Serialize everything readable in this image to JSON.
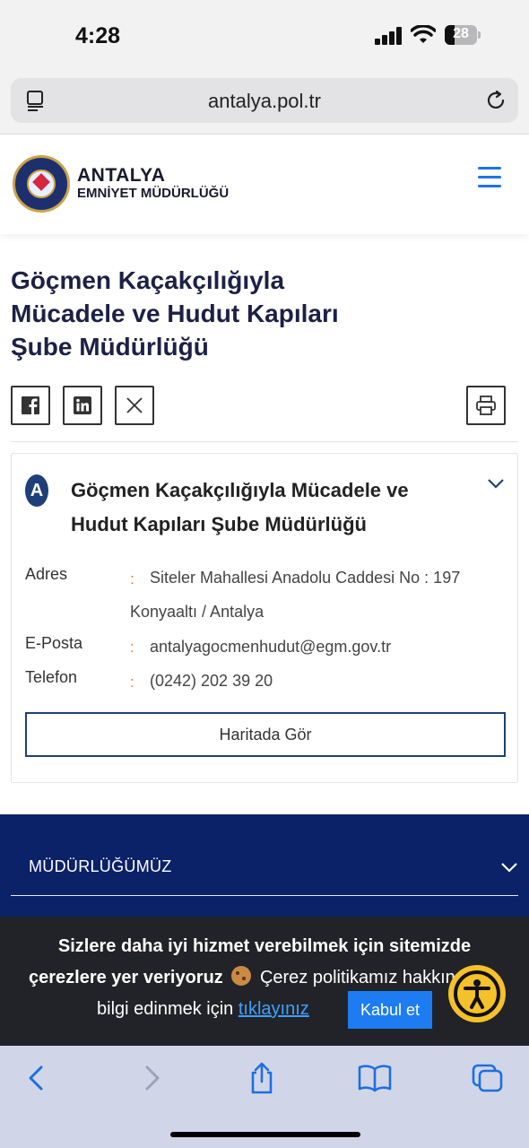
{
  "status_bar": {
    "time": "4:28",
    "battery": "28"
  },
  "browser": {
    "url": "antalya.pol.tr"
  },
  "site_header": {
    "title": "ANTALYA",
    "subtitle": "EMNİYET MÜDÜRLÜĞÜ"
  },
  "page": {
    "title": "Göçmen Kaçakçılığıyla Mücadele ve Hudut Kapıları Şube Müdürlüğü"
  },
  "card": {
    "letter": "A",
    "title": "Göçmen Kaçakçılığıyla Mücadele ve Hudut Kapıları Şube Müdürlüğü",
    "colon": ":",
    "address_label": "Adres",
    "address_line1": "Siteler Mahallesi Anadolu Caddesi No : 197",
    "address_line2": "Konyaaltı / Antalya",
    "email_label": "E-Posta",
    "email_value": "antalyagocmenhudut@egm.gov.tr",
    "phone_label": "Telefon",
    "phone_value": "(0242) 202 39 20",
    "map_button": "Haritada Gör"
  },
  "footer": {
    "menu_item": "MÜDÜRLÜĞÜMÜZ"
  },
  "cookie_banner": {
    "line1": "Sizlere daha iyi hizmet verebilmek için sitemizde",
    "line2_bold": "çerezlere yer veriyoruz",
    "line2_rest": "Çerez politikamız hakkında",
    "line3_prefix": "bilgi edinmek için",
    "link": "tıklayınız",
    "accept": "Kabul et"
  },
  "colors": {
    "navy": "#0b2269",
    "accent_blue": "#1e7cf2",
    "title_navy": "#1c2145",
    "orange_colon": "#e07a26",
    "a11y_yellow": "#f5c12a"
  }
}
